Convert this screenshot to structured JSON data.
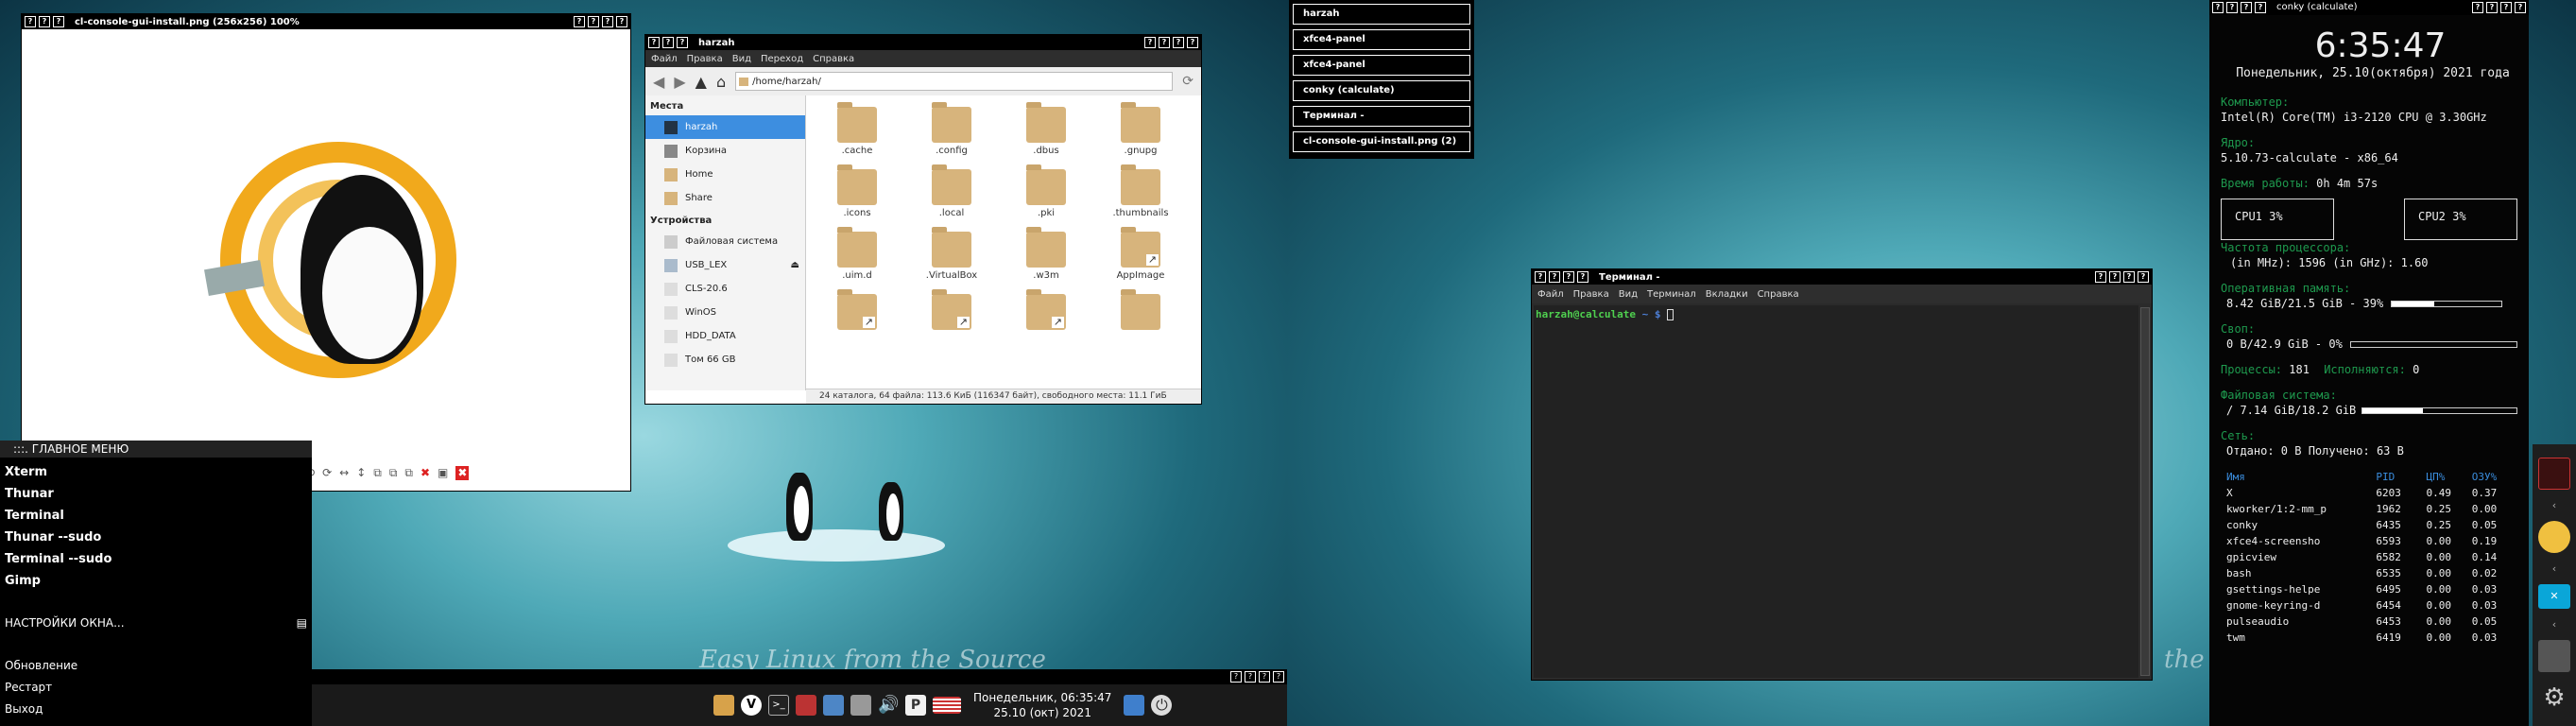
{
  "viewer": {
    "title": "cl-console-gui-install.png (256x256) 100%",
    "toolbar": [
      "⟲",
      "⟳",
      "↔",
      "↕",
      "⧉",
      "⧉",
      "⧉",
      "✖",
      "▣",
      "✖"
    ]
  },
  "menu": {
    "header": ":::. ГЛАВНОЕ МЕНЮ",
    "items": [
      "Xterm",
      "Thunar",
      "Terminal",
      "Thunar --sudo",
      "Terminal --sudo",
      "Gimp"
    ],
    "settings": "НАСТРОЙКИ ОКНА...",
    "footer": [
      "Обновление",
      "Рестарт",
      "Выход"
    ]
  },
  "thunar": {
    "title": "harzah",
    "menu": [
      "Файл",
      "Правка",
      "Вид",
      "Переход",
      "Справка"
    ],
    "path": "/home/harzah/",
    "places_header": "Места",
    "places": [
      "harzah",
      "Корзина",
      "Home",
      "Share"
    ],
    "devices_header": "Устройства",
    "devices": [
      "Файловая система",
      "USB_LEX",
      "CLS-20.6",
      "WinOS",
      "HDD_DATA",
      "Том 66 GB"
    ],
    "files": [
      ".cache",
      ".config",
      ".dbus",
      ".gnupg",
      ".icons",
      ".local",
      ".pki",
      ".thumbnails",
      ".uim.d",
      ".VirtualBox",
      ".w3m",
      "AppImage",
      "",
      "",
      "",
      ""
    ],
    "status": "24 каталога, 64 файла: 113.6 КиБ (116347 байт), свободного места: 11.1 ГиБ"
  },
  "tasklist": [
    "harzah",
    "xfce4-panel",
    "xfce4-panel",
    "conky (calculate)",
    "Терминал -",
    "cl-console-gui-install.png (2)"
  ],
  "panel": {
    "clock1": "Понедельник, 06:35:47",
    "clock2": "25.10 (окт) 2021"
  },
  "wallpaper_text": "Easy Linux from the Source",
  "terminal": {
    "title": "Терминал -",
    "menu": [
      "Файл",
      "Правка",
      "Вид",
      "Терминал",
      "Вкладки",
      "Справка"
    ],
    "user": "harzah@calculate",
    "tilde": "~",
    "dollar": "$"
  },
  "conky": {
    "title": "conky (calculate)",
    "time": "6:35:47",
    "date": "Понедельник, 25.10(октября) 2021 года",
    "comp_label": "Компьютер:",
    "cpu_model": "Intel(R) Core(TM) i3-2120 CPU @ 3.30GHz",
    "kernel_label": "Ядро:",
    "kernel": "5.10.73-calculate - x86_64",
    "uptime_label": "Время работы:",
    "uptime": "0h 4m 57s",
    "cpu1": "CPU1  3%",
    "cpu2": "CPU2  3%",
    "freq_label": "Частота процессора:",
    "freq": "(in MHz): 1596 (in GHz): 1.60",
    "ram_label": "Оперативная память:",
    "ram": "8.42 GiB/21.5 GiB - 39%",
    "ram_pct": 39,
    "swap_label": "Своп:",
    "swap": "0 B/42.9 GiB - 0%",
    "swap_pct": 0,
    "proc_label": "Процессы:",
    "proc_count": "181",
    "running_label": "Исполняются:",
    "running": "0",
    "fs_label": "Файловая система:",
    "fs": "/ 7.14 GiB/18.2 GiB",
    "fs_pct": 39,
    "net_label": "Сеть:",
    "net": "Отдано: 0 B  Получено: 63 B",
    "table_headers": [
      "Имя",
      "PID",
      "ЦП%",
      "ОЗУ%"
    ],
    "processes": [
      [
        "X",
        "6203",
        "0.49",
        "0.37"
      ],
      [
        "kworker/1:2-mm_p",
        "1962",
        "0.25",
        "0.00"
      ],
      [
        "conky",
        "6435",
        "0.25",
        "0.05"
      ],
      [
        "xfce4-screensho",
        "6593",
        "0.00",
        "0.19"
      ],
      [
        "gpicview",
        "6582",
        "0.00",
        "0.14"
      ],
      [
        "bash",
        "6535",
        "0.00",
        "0.02"
      ],
      [
        "gsettings-helpe",
        "6495",
        "0.00",
        "0.03"
      ],
      [
        "gnome-keyring-d",
        "6454",
        "0.00",
        "0.03"
      ],
      [
        "pulseaudio",
        "6453",
        "0.00",
        "0.05"
      ],
      [
        "twm",
        "6419",
        "0.00",
        "0.03"
      ]
    ]
  },
  "colors": {
    "title_bar": "#000000",
    "conky_green": "#1e9a4e",
    "selection": "#3d8ee0",
    "folder": "#d7b47c"
  }
}
